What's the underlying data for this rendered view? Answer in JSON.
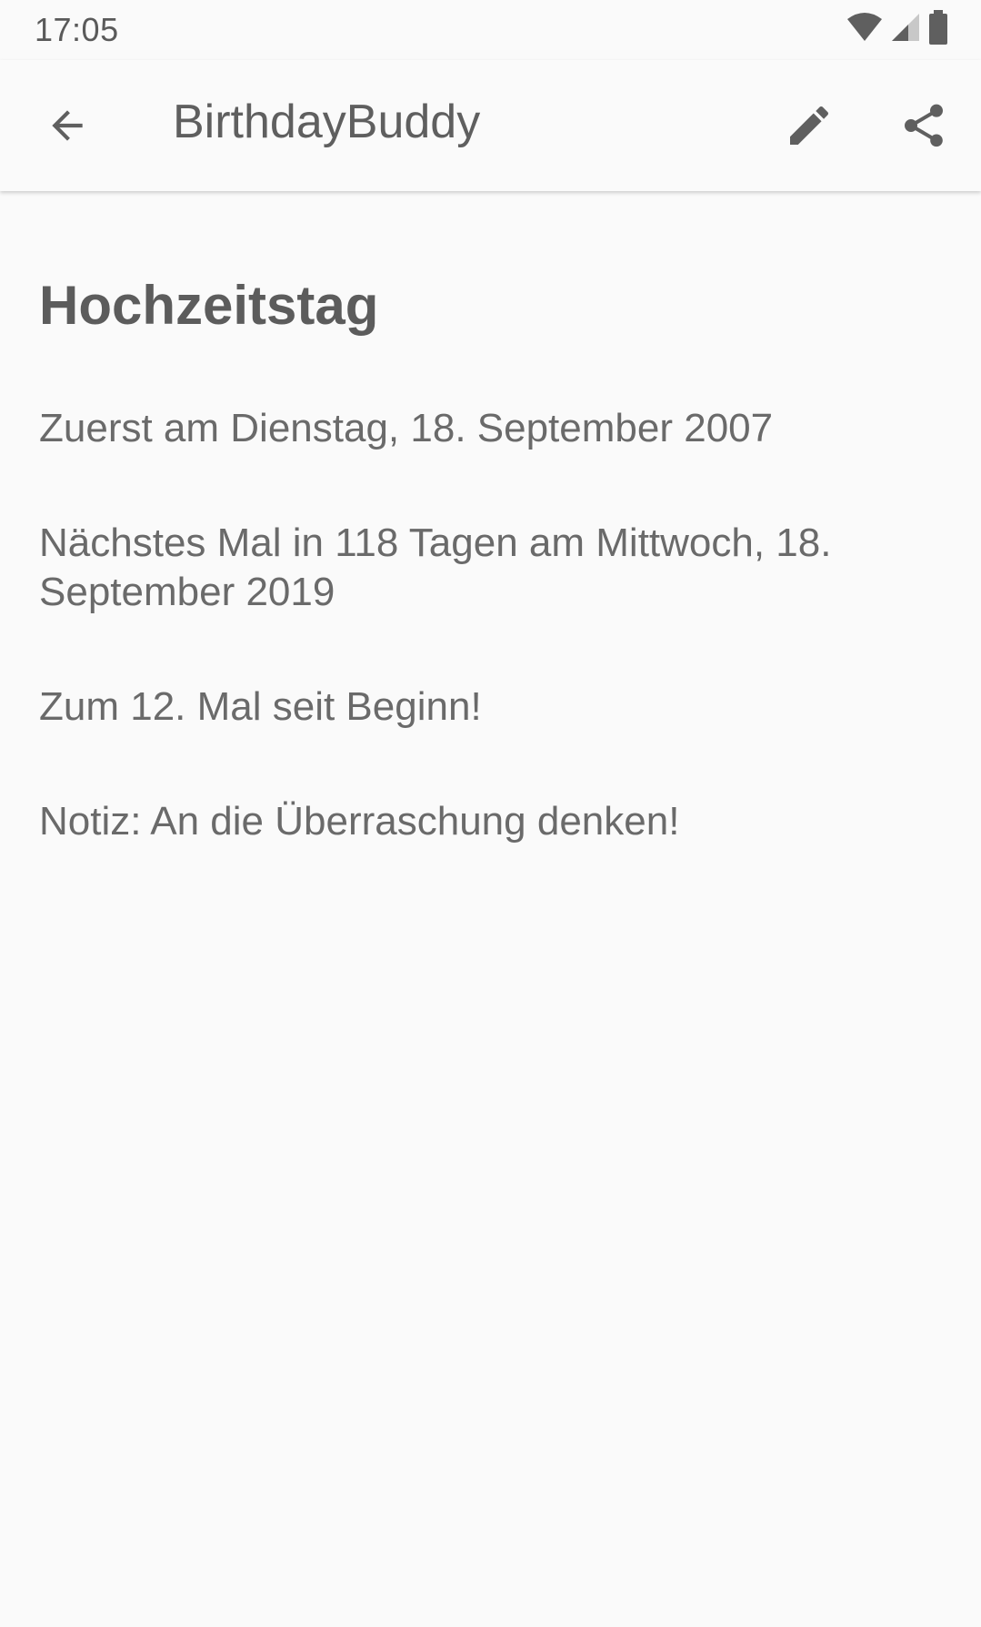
{
  "status_bar": {
    "time": "17:05",
    "icons": [
      "wifi-icon",
      "cellular-signal-icon",
      "battery-icon"
    ]
  },
  "app_bar": {
    "title": "BirthdayBuddy",
    "back_icon": "arrow-back-icon",
    "actions": [
      {
        "name": "edit",
        "icon": "pencil-icon"
      },
      {
        "name": "share",
        "icon": "share-icon"
      }
    ]
  },
  "event": {
    "title": "Hochzeitstag",
    "first_date": "Zuerst am Dienstag, 18. September 2007",
    "next_occurrence": "Nächstes Mal in 118 Tagen am Mittwoch, 18. September 2019",
    "count": "Zum 12. Mal seit Beginn!",
    "note": "Notiz: An die Überraschung denken!"
  },
  "colors": {
    "background": "#fafafa",
    "text": "#5f5f5f",
    "icon": "#5f5f5f"
  }
}
